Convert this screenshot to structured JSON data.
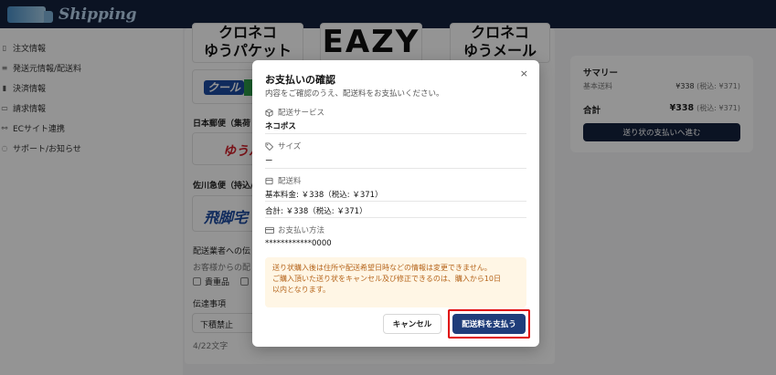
{
  "header": {
    "logo_text": "Shipping"
  },
  "sidebar": {
    "items": [
      {
        "icon": "document-icon",
        "glyph": "▯",
        "label": "注文情報"
      },
      {
        "icon": "list-icon",
        "glyph": "≡",
        "label": "発送元情報/配送料"
      },
      {
        "icon": "bar-chart-icon",
        "glyph": "▮",
        "label": "決済情報"
      },
      {
        "icon": "folder-icon",
        "glyph": "▭",
        "label": "請求情報"
      },
      {
        "icon": "link-icon",
        "glyph": "⚯",
        "label": "ECサイト連携"
      },
      {
        "icon": "help-icon",
        "glyph": "◌",
        "label": "サポート/お知らせ"
      }
    ]
  },
  "main": {
    "carrier_1": [
      "クロネコ",
      "ゆうパケット"
    ],
    "carrier_2": "EAZY",
    "carrier_3": [
      "クロネコ",
      "ゆうメール"
    ],
    "cool_badge": "クール",
    "japan_post_label": "日本郵便（集荷",
    "yupack_text": "ゆうパ",
    "sagawa_label": "佐川急便（持込/",
    "hikyaku_text": "飛脚宅",
    "notes_label": "配送業者への伝",
    "notes_sub": "お客様からの配",
    "checkbox_label": "貴重品",
    "message_label": "伝達事項",
    "message_value": "下積禁止",
    "char_count": "4/22文字"
  },
  "summary": {
    "title": "サマリー",
    "base_label": "基本送料",
    "base_value": "¥338",
    "base_tax": "(税込: ¥371)",
    "total_label": "合計",
    "total_value": "¥338",
    "total_tax": "(税込: ¥371)",
    "button_label": "送り状の支払いへ進む"
  },
  "modal": {
    "title": "お支払いの確認",
    "subtitle": "内容をご確認のうえ、配送料をお支払いください。",
    "close_label": "×",
    "service_label": "配送サービス",
    "service_value": "ネコポス",
    "size_label": "サイズ",
    "size_value": "ー",
    "fee_label": "配送料",
    "base_fee": "基本料金: ￥338（税込: ￥371）",
    "total_fee": "合計: ￥338（税込: ￥371）",
    "payment_label": "お支払い方法",
    "payment_value": "************0000",
    "notice_line1": "送り状購入後は住所や配送希望日時などの情報は変更できません。",
    "notice_line2": "ご購入頂いた送り状をキャンセル及び修正できるのは、購入から10日",
    "notice_line3": "以内となります。",
    "cancel_label": "キャンセル",
    "pay_label": "配送料を支払う"
  },
  "colors": {
    "header": "#14213d",
    "primary_button": "#1f3d7a",
    "notice_bg": "#fff6e5",
    "notice_text": "#b5641a",
    "highlight": "#e00000"
  }
}
